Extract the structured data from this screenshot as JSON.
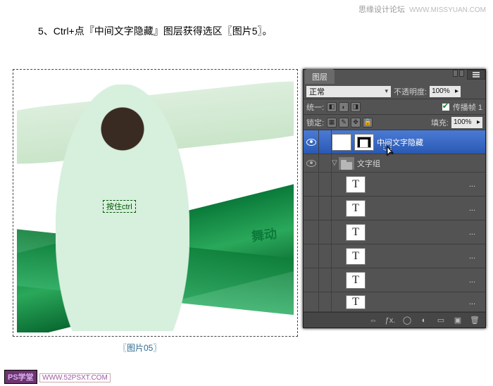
{
  "watermark": {
    "site": "思缘设计论坛",
    "url": "WWW.MISSYUAN.COM"
  },
  "instruction": "5、Ctrl+点『中间文字隐藏』图层获得选区〖图片5〗。",
  "canvas": {
    "ribbon_text": "舞动",
    "ctrl_hint": "按住ctrl"
  },
  "image_caption": "〖图片05〗",
  "panel": {
    "tab": "图层",
    "blend_mode": "正常",
    "opacity_label": "不透明度:",
    "opacity_value": "100%",
    "unify_label": "统一:",
    "propagate_label": "传播帧 1",
    "lock_label": "锁定:",
    "fill_label": "填充:",
    "fill_value": "100%",
    "layers": {
      "selected": {
        "name": "中间文字隐藏"
      },
      "group": {
        "name": "文字组"
      },
      "text_items": [
        {
          "name": "..."
        },
        {
          "name": "..."
        },
        {
          "name": "..."
        },
        {
          "name": "..."
        },
        {
          "name": "..."
        },
        {
          "name": "..."
        }
      ]
    }
  },
  "footer": {
    "logo": "PS学堂",
    "url": "WWW.52PSXT.COM"
  }
}
